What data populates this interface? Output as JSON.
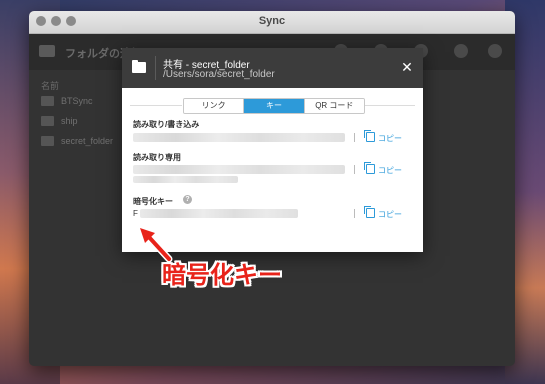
{
  "window": {
    "title": "Sync"
  },
  "toolbar": {
    "folder_text": "フォルダの追加"
  },
  "list": {
    "header": "名前",
    "items": [
      {
        "name": "BTSync"
      },
      {
        "name": "ship"
      },
      {
        "name": "secret_folder"
      }
    ]
  },
  "dialog": {
    "title": "共有 - secret_folder",
    "path": "/Users/sora/secret_folder",
    "close": "✕",
    "tabs": [
      {
        "label": "リンク"
      },
      {
        "label": "キー"
      },
      {
        "label": "QR コード"
      }
    ],
    "active_tab": "キー",
    "sections": [
      {
        "label": "読み取り/書き込み",
        "copy_label": "コピー"
      },
      {
        "label": "読み取り専用",
        "copy_label": "コピー"
      },
      {
        "label": "暗号化キー",
        "copy_label": "コピー",
        "help": "?",
        "key_prefix": "F"
      }
    ]
  },
  "annotation": {
    "text": "暗号化キー"
  },
  "colors": {
    "accent": "#2d9ad9",
    "annotation": "#e8231a"
  }
}
